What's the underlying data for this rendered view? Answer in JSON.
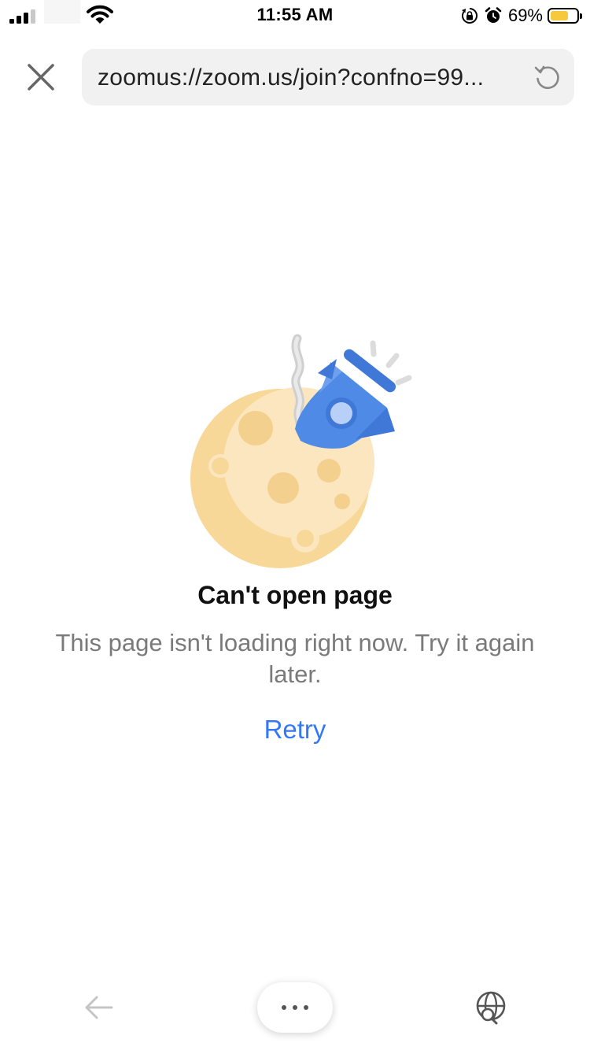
{
  "status_bar": {
    "time": "11:55 AM",
    "battery_percent": "69%",
    "battery_level": 0.69,
    "signal_bars_active": 3,
    "icons": [
      "cellular-signal-icon",
      "wifi-icon",
      "orientation-lock-icon",
      "alarm-icon",
      "battery-icon"
    ]
  },
  "browser": {
    "url": "zoomus://zoom.us/join?confno=99...",
    "icons": {
      "close": "close-icon",
      "reload": "reload-icon"
    }
  },
  "error": {
    "title": "Can't open page",
    "message": "This page isn't loading right now. Try it again later.",
    "retry_label": "Retry",
    "illustration": "crashed-rocket-on-moon-illustration"
  },
  "toolbar": {
    "icons": {
      "back": "back-arrow-icon",
      "more": "more-options-icon",
      "globe": "globe-search-icon"
    }
  },
  "colors": {
    "accent": "#3478f6",
    "url_bar_bg": "#f1f1f2",
    "message_text": "#7a7a7a",
    "moon": "#f7d898",
    "rocket": "#4e8ae6",
    "battery_fill": "#f6c83c"
  }
}
